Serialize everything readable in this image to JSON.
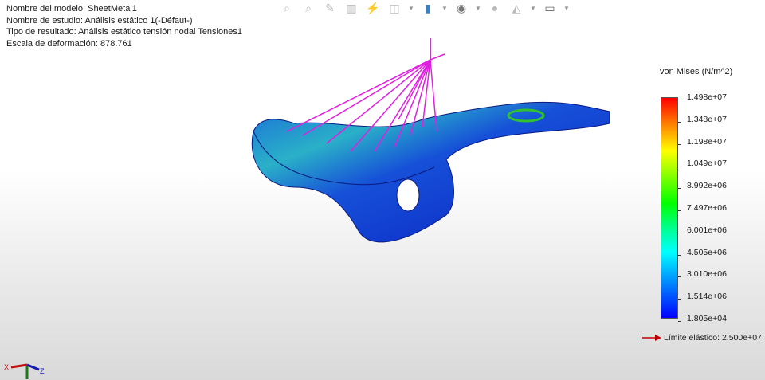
{
  "info": {
    "model_name": "Nombre del modelo: SheetMetal1",
    "study_name": "Nombre de estudio: Análisis estático 1(-Défaut-)",
    "result_type": "Tipo de resultado: Análisis estático tensión nodal Tensiones1",
    "deformation_scale": "Escala de deformación: 878.761"
  },
  "toolbar": {
    "icons": [
      "zoom-to-fit-icon",
      "zoom-to-area-icon",
      "previous-view-icon",
      "section-view-icon",
      "view-settings-icon",
      "view-orientation-icon",
      "display-style-icon",
      "hide-show-icon",
      "edit-appearance-icon",
      "apply-scene-icon",
      "view-settings-display-icon"
    ]
  },
  "legend": {
    "title": "von Mises (N/m^2)",
    "labels": [
      "1.498e+07",
      "1.348e+07",
      "1.198e+07",
      "1.049e+07",
      "8.992e+06",
      "7.497e+06",
      "6.001e+06",
      "4.505e+06",
      "3.010e+06",
      "1.514e+06",
      "1.805e+04"
    ],
    "yield": "Límite elástico: 2.500e+07",
    "yield_arrow_color": "#c00000"
  },
  "axes": {
    "x": "X",
    "z": "Z"
  }
}
